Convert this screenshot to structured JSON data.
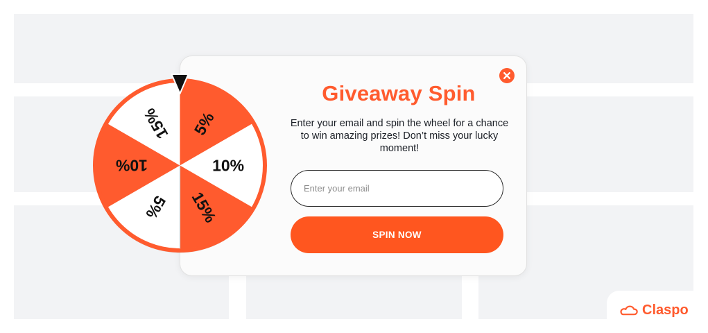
{
  "popup": {
    "title": "Giveaway Spin",
    "description": "Enter your email and spin the wheel for a chance to win amazing prizes! Don’t miss your lucky moment!",
    "email_placeholder": "Enter your email",
    "email_value": "",
    "spin_button_label": "SPIN NOW"
  },
  "wheel": {
    "segments": [
      {
        "label": "5%",
        "color": "orange"
      },
      {
        "label": "10%",
        "color": "white"
      },
      {
        "label": "15%",
        "color": "orange"
      },
      {
        "label": "5%",
        "color": "white"
      },
      {
        "label": "10%",
        "color": "orange"
      },
      {
        "label": "15%",
        "color": "white"
      }
    ]
  },
  "brand": {
    "logo_text": "Claspo"
  },
  "icons": {
    "close": "close-icon",
    "pointer": "triangle-pointer-icon",
    "brand": "cloud-logo-icon"
  },
  "colors": {
    "accent": "#ff5b2e",
    "button": "#ff561f",
    "background_block": "#f2f3f5",
    "text_dark": "#1b1f26"
  }
}
